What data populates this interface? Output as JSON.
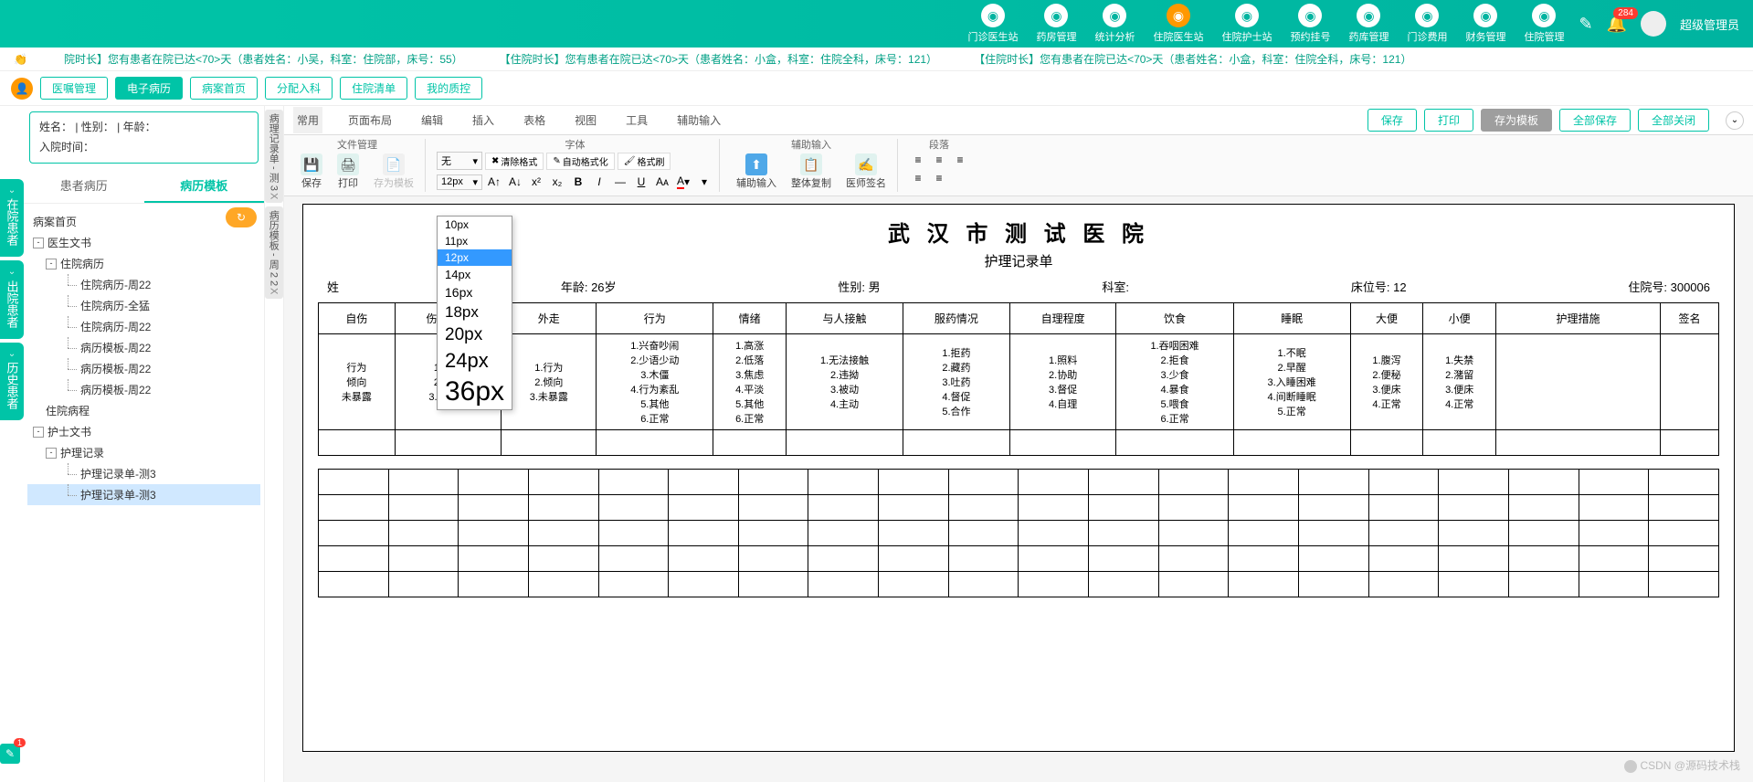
{
  "top_nav": [
    {
      "label": "门诊医生站"
    },
    {
      "label": "药房管理"
    },
    {
      "label": "统计分析"
    },
    {
      "label": "住院医生站",
      "active": true
    },
    {
      "label": "住院护士站"
    },
    {
      "label": "预约挂号"
    },
    {
      "label": "药库管理"
    },
    {
      "label": "门诊费用"
    },
    {
      "label": "财务管理"
    },
    {
      "label": "住院管理"
    }
  ],
  "notification_count": "284",
  "user_name": "超级管理员",
  "marquee": [
    "院时长】您有患者在院已达<70>天（患者姓名：小吴，科室：住院部，床号：55）",
    "【住院时长】您有患者在院已达<70>天（患者姓名：小盒，科室：住院全科，床号：121）",
    "【住院时长】您有患者在院已达<70>天（患者姓名：小盒，科室：住院全科，床号：121）"
  ],
  "toolbar": {
    "buttons": [
      "医嘱管理",
      "电子病历",
      "病案首页",
      "分配入科",
      "住院清单",
      "我的质控"
    ],
    "active_idx": 1
  },
  "left_tabs": [
    "在院患者",
    "出院患者",
    "历史患者"
  ],
  "left_bottom_badge": "1",
  "patient_info": {
    "line1": "姓名：  | 性别：  | 年龄：",
    "line2": "入院时间："
  },
  "side_tabs": {
    "items": [
      "患者病历",
      "病历模板"
    ],
    "active_idx": 1
  },
  "tree": [
    {
      "label": "病案首页",
      "level": 0,
      "leaf": true
    },
    {
      "label": "医生文书",
      "level": 0,
      "toggle": "-"
    },
    {
      "label": "住院病历",
      "level": 1,
      "toggle": "-"
    },
    {
      "label": "住院病历-周22",
      "level": 3,
      "leaf": true
    },
    {
      "label": "住院病历-全猛",
      "level": 3,
      "leaf": true
    },
    {
      "label": "住院病历-周22",
      "level": 3,
      "leaf": true
    },
    {
      "label": "病历模板-周22",
      "level": 3,
      "leaf": true
    },
    {
      "label": "病历模板-周22",
      "level": 3,
      "leaf": true
    },
    {
      "label": "病历模板-周22",
      "level": 3,
      "leaf": true
    },
    {
      "label": "住院病程",
      "level": 1,
      "leaf": true
    },
    {
      "label": "护士文书",
      "level": 0,
      "toggle": "-"
    },
    {
      "label": "护理记录",
      "level": 1,
      "toggle": "-"
    },
    {
      "label": "护理记录单-测3",
      "level": 3,
      "leaf": true
    },
    {
      "label": "护理记录单-测3",
      "level": 3,
      "leaf": true,
      "selected": true
    }
  ],
  "vert_tabs": [
    {
      "label": "病理记录单 - 测 3",
      "close": "X"
    },
    {
      "label": "病历模板 - 周 2 2",
      "close": "X"
    }
  ],
  "editor_menus": [
    "常用",
    "页面布局",
    "编辑",
    "插入",
    "表格",
    "视图",
    "工具",
    "辅助输入"
  ],
  "editor_actions": {
    "save": "保存",
    "print": "打印",
    "save_tpl": "存为模板",
    "save_all": "全部保存",
    "close_all": "全部关闭"
  },
  "ribbon": {
    "file_group": "文件管理",
    "font_group": "字体",
    "assist_group": "辅助输入",
    "para_group": "段落",
    "save": "保存",
    "print": "打印",
    "save_tpl": "存为模板",
    "font_name": "无",
    "font_size": "12px",
    "clear_fmt": "清除格式",
    "auto_fmt": "自动格式化",
    "fmt_paint": "格式刷",
    "assist_input": "辅助输入",
    "copy_whole": "整体复制",
    "doctor_sign": "医师签名"
  },
  "size_dropdown": [
    "10px",
    "11px",
    "12px",
    "14px",
    "16px",
    "18px",
    "20px",
    "24px",
    "36px"
  ],
  "size_selected": "12px",
  "doc": {
    "title": "武 汉 市 测 试 医 院",
    "subtitle": "护理记录单",
    "info": {
      "name": "姓",
      "age": "年龄: 26岁",
      "sex": "性别: 男",
      "dept": "科室:",
      "bed": "床位号: 12",
      "hosp_no": "住院号: 300006"
    },
    "headers": [
      "自伤",
      "伤人毁物",
      "外走",
      "行为",
      "情绪",
      "与人接触",
      "服药情况",
      "自理程度",
      "饮食",
      "睡眠",
      "大便",
      "小便",
      "护理措施",
      "签名"
    ],
    "row_cells": [
      [
        "行为",
        "倾向",
        "未暴露"
      ],
      [
        "1.行为",
        "2.倾向",
        "3.未暴露"
      ],
      [
        "1.行为",
        "2.倾向",
        "3.未暴露"
      ],
      [
        "1.兴奋吵闹",
        "2.少语少动",
        "3.木僵",
        "4.行为紊乱",
        "5.其他",
        "6.正常"
      ],
      [
        "1.高涨",
        "2.低落",
        "3.焦虑",
        "4.平淡",
        "5.其他",
        "6.正常"
      ],
      [
        "1.无法接触",
        "2.违拗",
        "3.被动",
        "4.主动"
      ],
      [
        "1.拒药",
        "2.藏药",
        "3.吐药",
        "4.督促",
        "5.合作"
      ],
      [
        "1.照料",
        "2.协助",
        "3.督促",
        "4.自理"
      ],
      [
        "1.吞咽困难",
        "2.拒食",
        "3.少食",
        "4.暴食",
        "5.喂食",
        "6.正常"
      ],
      [
        "1.不眠",
        "2.早醒",
        "3.入睡困难",
        "4.间断睡眠",
        "5.正常"
      ],
      [
        "1.腹泻",
        "2.便秘",
        "3.便床",
        "4.正常"
      ],
      [
        "1.失禁",
        "2.潴留",
        "3.便床",
        "4.正常"
      ],
      [],
      []
    ]
  },
  "watermark": "CSDN @源码技术栈"
}
